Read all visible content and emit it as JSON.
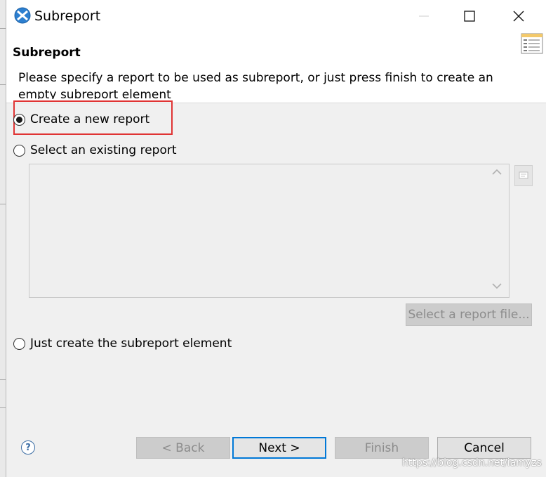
{
  "window": {
    "title": "Subreport"
  },
  "header": {
    "title": "Subreport",
    "description_line1": "Please specify a report to be used as subreport, or just press finish to create an",
    "description_line2": "empty subreport element"
  },
  "options": {
    "create_new": {
      "label": "Create a new report",
      "selected": true
    },
    "select_existing": {
      "label": "Select an existing report",
      "selected": false
    },
    "just_create": {
      "label": "Just create the subreport element",
      "selected": false
    }
  },
  "select_file_button": "Select a report file...",
  "footer": {
    "back": "< Back",
    "next": "Next >",
    "finish": "Finish",
    "cancel": "Cancel",
    "help": "?"
  },
  "watermark": "https://blog.csdn.net/iamyzs",
  "colors": {
    "highlight": "#e03434",
    "focus": "#0078d7"
  }
}
